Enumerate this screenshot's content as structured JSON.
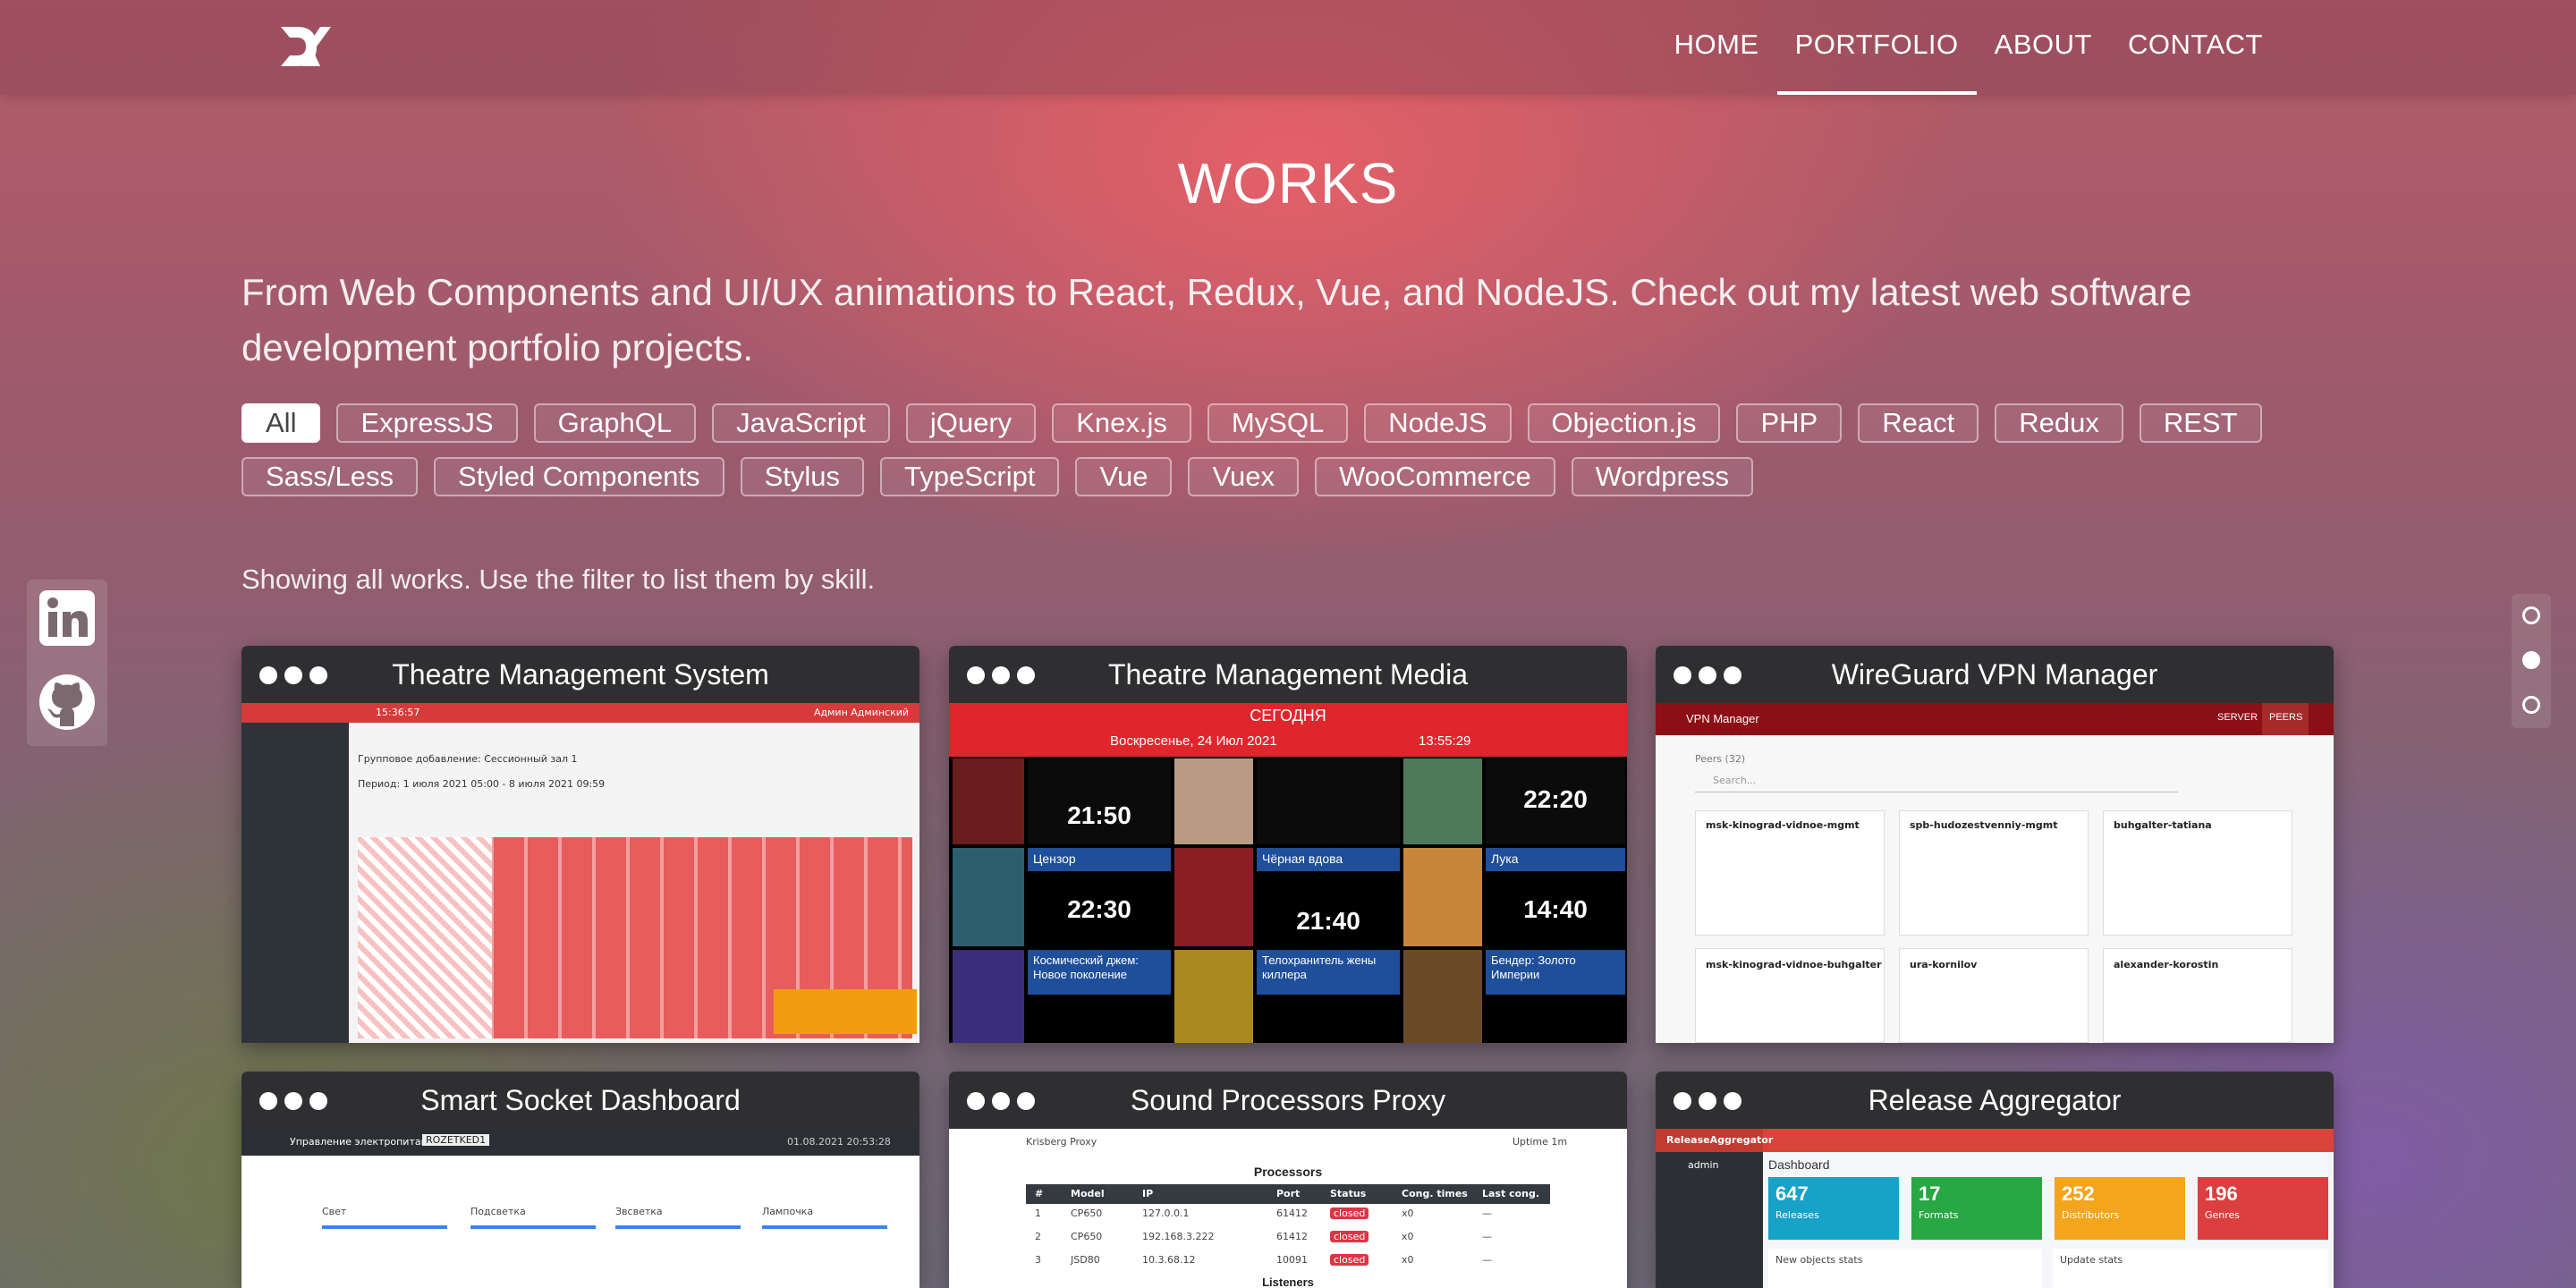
{
  "nav": {
    "items": [
      {
        "label": "HOME",
        "active": false
      },
      {
        "label": "PORTFOLIO",
        "active": true
      },
      {
        "label": "ABOUT",
        "active": false
      },
      {
        "label": "CONTACT",
        "active": false
      }
    ]
  },
  "page": {
    "title": "WORKS",
    "intro": "From Web Components and UI/UX animations to React, Redux, Vue, and NodeJS. Check out my latest web software development portfolio projects.",
    "showing": "Showing all works. Use the filter to list them by skill."
  },
  "filters": {
    "row1": [
      "All",
      "ExpressJS",
      "GraphQL",
      "JavaScript",
      "jQuery",
      "Knex.js",
      "MySQL",
      "NodeJS",
      "Objection.js",
      "PHP",
      "React",
      "Redux",
      "REST"
    ],
    "row2": [
      "Sass/Less",
      "Styled Components",
      "Stylus",
      "TypeScript",
      "Vue",
      "Vuex",
      "WooCommerce",
      "Wordpress"
    ],
    "active": "All"
  },
  "cards": [
    {
      "title": "Theatre Management System"
    },
    {
      "title": "Theatre Management Media"
    },
    {
      "title": "WireGuard VPN Manager"
    },
    {
      "title": "Smart Socket Dashboard"
    },
    {
      "title": "Sound Processors Proxy"
    },
    {
      "title": "Release Aggregator"
    }
  ],
  "shots": {
    "tms": {
      "time": "15:36:57",
      "user": "Админ Админский",
      "banner": "Групповое добавление: Сессионный зал 1",
      "period": "Период: 1 июля 2021 05:00 - 8 июля 2021 09:59"
    },
    "media": {
      "header": "СЕГОДНЯ",
      "date": "Воскресенье, 24 Июл 2021",
      "clock": "13:55:29",
      "times": [
        "21:50",
        "22:20",
        "22:30",
        "21:40",
        "14:40"
      ],
      "movies": [
        "Цензор",
        "Чёрная вдова",
        "Лука",
        "Космический джем: Новое поколение",
        "Телохранитель жены киллера",
        "Бендер: Золото Империи"
      ]
    },
    "vpn": {
      "app": "VPN Manager",
      "tabs": [
        "SERVER",
        "PEERS"
      ],
      "peers_label": "Peers (32)",
      "search": "Search...",
      "peers": [
        "msk-kinograd-vidnoe-mgmt",
        "spb-hudozestvenniy-mgmt",
        "buhgalter-tatiana",
        "msk-kinograd-vidnoe-buhgalter",
        "ura-kornilov",
        "alexander-korostin"
      ]
    },
    "socket": {
      "header": "Управление электропитанием",
      "device": "ROZETKED1",
      "date": "01.08.2021 20:53:28",
      "groups": [
        "Свет",
        "Подсветка",
        "Звсветка",
        "Лампочка"
      ]
    },
    "sound": {
      "app": "Krisberg Proxy",
      "uptime": "Uptime 1m",
      "section": "Processors",
      "cols": [
        "#",
        "Model",
        "IP",
        "Port",
        "Status",
        "Cong. times",
        "Last cong."
      ],
      "rows": [
        [
          "1",
          "CP650",
          "127.0.0.1",
          "61412",
          "closed",
          "x0",
          "—"
        ],
        [
          "2",
          "CP650",
          "192.168.3.222",
          "61412",
          "closed",
          "x0",
          "—"
        ],
        [
          "3",
          "JSD80",
          "10.3.68.12",
          "10091",
          "closed",
          "x0",
          "—"
        ]
      ],
      "footer": "Listeners"
    },
    "release": {
      "app": "ReleaseAggregator",
      "user": "admin",
      "title": "Dashboard",
      "stats": [
        {
          "value": "647",
          "label": "Releases",
          "color": "#17a2c8"
        },
        {
          "value": "17",
          "label": "Formats",
          "color": "#28a745"
        },
        {
          "value": "252",
          "label": "Distributors",
          "color": "#f3a51c"
        },
        {
          "value": "196",
          "label": "Genres",
          "color": "#dc3f3f"
        }
      ],
      "panels": [
        "New objects stats",
        "Update stats"
      ]
    }
  }
}
